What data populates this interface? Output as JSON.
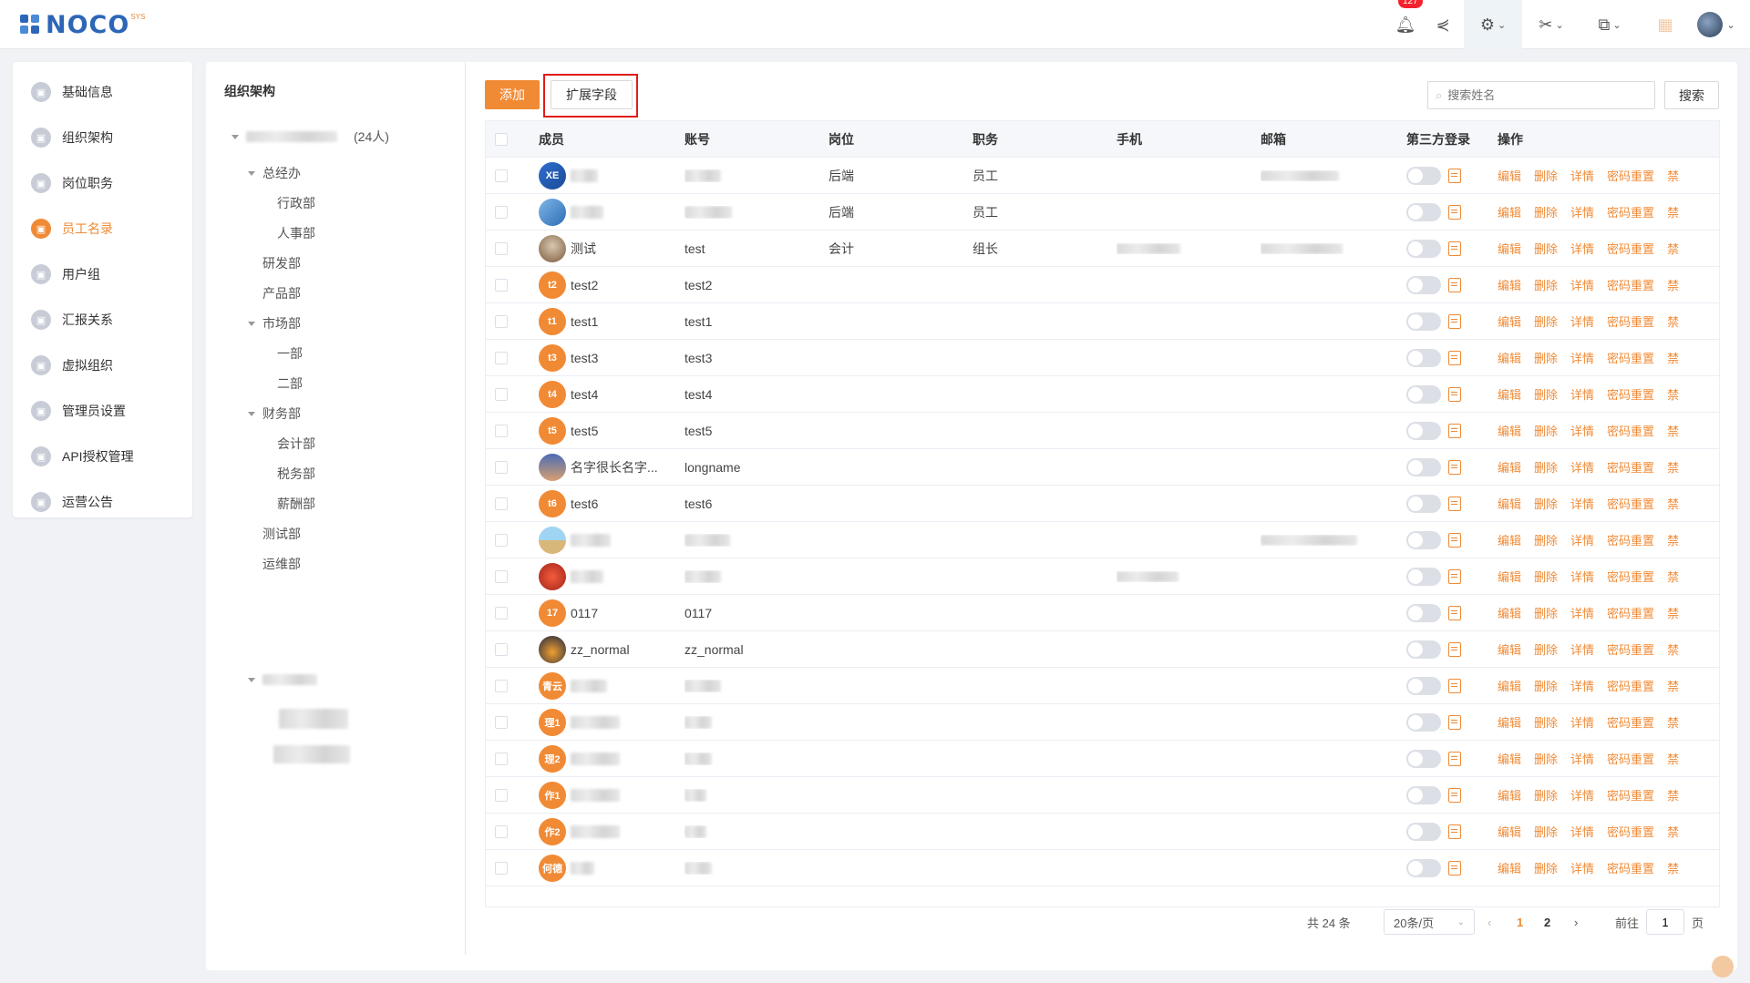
{
  "app": {
    "logo_text": "NOCO",
    "logo_sup": "SYS",
    "notification_count": "127"
  },
  "sidebar": {
    "items": [
      {
        "label": "基础信息",
        "icon": "info-icon"
      },
      {
        "label": "组织架构",
        "icon": "org-icon"
      },
      {
        "label": "岗位职务",
        "icon": "post-icon"
      },
      {
        "label": "员工名录",
        "icon": "staff-icon",
        "active": true
      },
      {
        "label": "用户组",
        "icon": "group-icon"
      },
      {
        "label": "汇报关系",
        "icon": "report-icon"
      },
      {
        "label": "虚拟组织",
        "icon": "virtual-org-icon"
      },
      {
        "label": "管理员设置",
        "icon": "admin-icon"
      },
      {
        "label": "API授权管理",
        "icon": "api-icon"
      },
      {
        "label": "运营公告",
        "icon": "notice-icon"
      }
    ]
  },
  "org": {
    "title": "组织架构",
    "root_count": "(24人)",
    "nodes": [
      "总经办",
      "行政部",
      "人事部",
      "研发部",
      "产品部",
      "市场部",
      "一部",
      "二部",
      "财务部",
      "会计部",
      "税务部",
      "薪酬部",
      "测试部",
      "运维部"
    ]
  },
  "toolbar": {
    "add_label": "添加",
    "ext_label": "扩展字段",
    "search_placeholder": "搜索姓名",
    "search_label": "搜索"
  },
  "table": {
    "headers": [
      "成员",
      "账号",
      "岗位",
      "职务",
      "手机",
      "邮箱",
      "第三方登录",
      "操作"
    ],
    "ops": [
      "编辑",
      "删除",
      "详情",
      "密码重置",
      "禁用"
    ],
    "rows": [
      {
        "avatar": "XE",
        "name": "",
        "account": "",
        "post": "后端",
        "duty": "员工"
      },
      {
        "avatar": "",
        "name": "",
        "account": "",
        "post": "后端",
        "duty": "员工"
      },
      {
        "avatar": "",
        "name": "测试",
        "account": "test",
        "post": "会计",
        "duty": "组长"
      },
      {
        "avatar": "t2",
        "name": "test2",
        "account": "test2",
        "post": "",
        "duty": ""
      },
      {
        "avatar": "t1",
        "name": "test1",
        "account": "test1",
        "post": "",
        "duty": ""
      },
      {
        "avatar": "t3",
        "name": "test3",
        "account": "test3",
        "post": "",
        "duty": ""
      },
      {
        "avatar": "t4",
        "name": "test4",
        "account": "test4",
        "post": "",
        "duty": ""
      },
      {
        "avatar": "t5",
        "name": "test5",
        "account": "test5",
        "post": "",
        "duty": ""
      },
      {
        "avatar": "",
        "name": "名字很长名字...",
        "account": "longname",
        "post": "",
        "duty": ""
      },
      {
        "avatar": "t6",
        "name": "test6",
        "account": "test6",
        "post": "",
        "duty": ""
      },
      {
        "avatar": "",
        "name": "",
        "account": "",
        "post": "",
        "duty": ""
      },
      {
        "avatar": "",
        "name": "",
        "account": "",
        "post": "",
        "duty": ""
      },
      {
        "avatar": "17",
        "name": "0117",
        "account": "0117",
        "post": "",
        "duty": ""
      },
      {
        "avatar": "",
        "name": "zz_normal",
        "account": "zz_normal",
        "post": "",
        "duty": ""
      },
      {
        "avatar": "青云",
        "name": "",
        "account": "",
        "post": "",
        "duty": ""
      },
      {
        "avatar": "理1",
        "name": "",
        "account": "",
        "post": "",
        "duty": ""
      },
      {
        "avatar": "理2",
        "name": "",
        "account": "",
        "post": "",
        "duty": ""
      },
      {
        "avatar": "作1",
        "name": "",
        "account": "",
        "post": "",
        "duty": ""
      },
      {
        "avatar": "作2",
        "name": "",
        "account": "",
        "post": "",
        "duty": ""
      },
      {
        "avatar": "何德",
        "name": "",
        "account": "",
        "post": "",
        "duty": ""
      }
    ]
  },
  "pagination": {
    "total": "共 24 条",
    "page_size": "20条/页",
    "pages": [
      "1",
      "2"
    ],
    "current": "1",
    "goto_label": "前往",
    "goto_value": "1",
    "page_unit": "页"
  },
  "colors": {
    "accent": "#f18a35",
    "highlight": "#e21b1b",
    "brand": "#2d66b8"
  }
}
